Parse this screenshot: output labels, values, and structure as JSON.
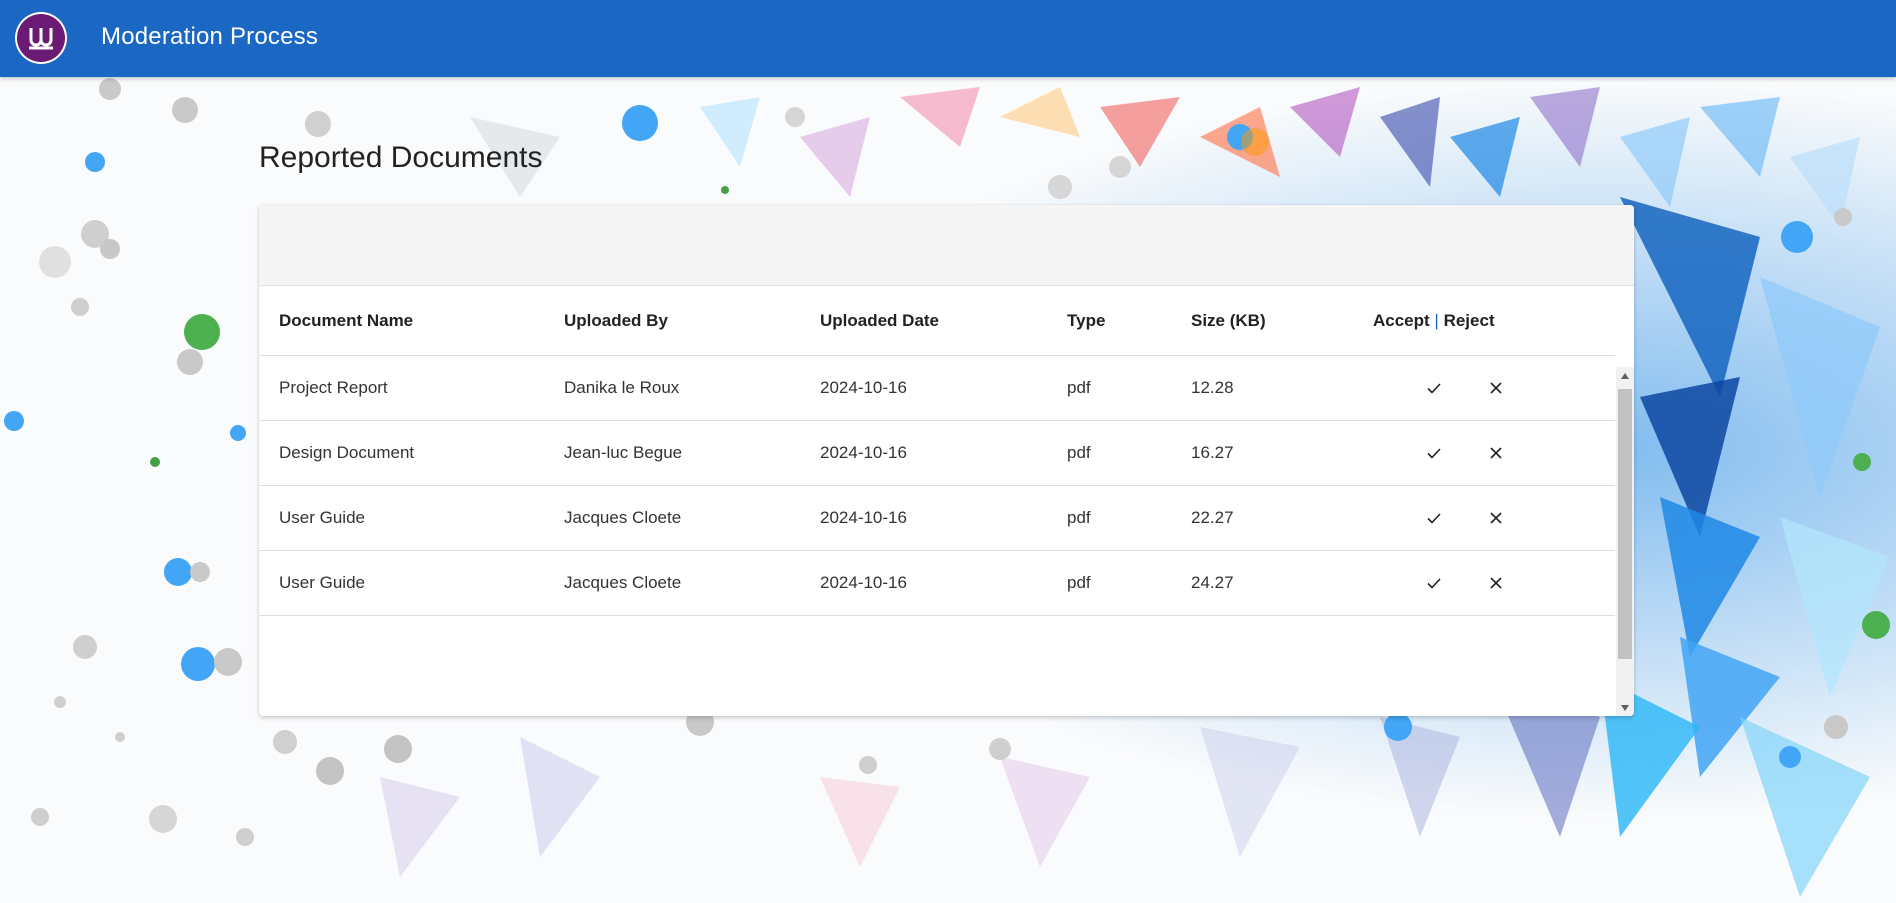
{
  "app": {
    "title": "Moderation Process",
    "logo_icon": "university-logo-icon",
    "header_color": "#1b68c4",
    "logo_color": "#6b1b73"
  },
  "page": {
    "title": "Reported Documents"
  },
  "table": {
    "headers": {
      "name": "Document Name",
      "uploaded_by": "Uploaded By",
      "uploaded_date": "Uploaded Date",
      "type": "Type",
      "size": "Size (KB)",
      "accept": "Accept",
      "separator": "|",
      "reject": "Reject"
    },
    "rows": [
      {
        "name": "Project Report",
        "uploaded_by": "Danika le Roux",
        "uploaded_date": "2024-10-16",
        "type": "pdf",
        "size": "12.28"
      },
      {
        "name": "Design Document",
        "uploaded_by": "Jean-luc Begue",
        "uploaded_date": "2024-10-16",
        "type": "pdf",
        "size": "16.27"
      },
      {
        "name": "User Guide",
        "uploaded_by": "Jacques Cloete",
        "uploaded_date": "2024-10-16",
        "type": "pdf",
        "size": "22.27"
      },
      {
        "name": "User Guide",
        "uploaded_by": "Jacques Cloete",
        "uploaded_date": "2024-10-16",
        "type": "pdf",
        "size": "24.27"
      }
    ],
    "action_icons": {
      "accept": "check-icon",
      "reject": "close-icon"
    }
  }
}
